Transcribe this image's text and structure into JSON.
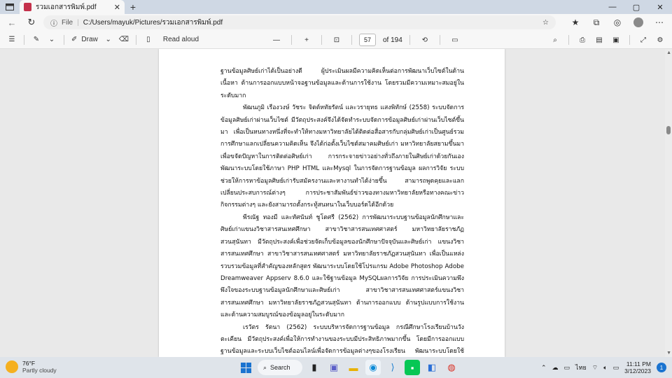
{
  "tab": {
    "title": "รวมเอกสารพิมพ์.pdf",
    "close": "✕",
    "new_tab": "+"
  },
  "window_controls": {
    "minimize": "—",
    "maximize": "▢",
    "close": "✕"
  },
  "address": {
    "scheme_label": "File",
    "url": "C:/Users/mayuk/Pictures/รวมเอกสารพิมพ์.pdf"
  },
  "pdf_toolbar": {
    "draw_label": "Draw",
    "read_aloud_label": "Read aloud",
    "zoom_out": "—",
    "zoom_in": "+",
    "current_page": "57",
    "total_pages": "of 194"
  },
  "document": {
    "paragraphs": [
      "ฐานข้อมูลศิษย์เก่าได้เป็นอย่างดี ผู้ประเมินผลมีความคิดเห็นต่อการพัฒนาเว็บไซต์ในด้านเนื้อหา ด้านการออกแบบหน้าจอฐานข้อมูลและด้านการใช้งาน โดยรวมมีความเหมาะสมอยู่ในระดับมาก",
      "พัฒนภูมิ เรืองวงษ์ วัชระ จิตต์หทัยรัตน์ และวรายุทธ แสงพิทักษ์ (2558) ระบบจัดการข้อมูลศิษย์เก่าผ่านเว็บไซต์ มีวัตถุประสงค์จึงได้จัดทำระบบจัดการข้อมูลศิษย์เก่าผ่านเว็บไซต์ขึ้นมา เพื่อเป็นหนทางหนึ่งที่จะทำให้ทางมหาวิทยาลัยได้ติดต่อสื่อสารกับกลุ่มศิษย์เก่าเป็นศูนย์รวมการศึกษาแลกเปลี่ยนความคิดเห็น จึงได้ก่อตั้งเว็บไซต์สมาคมศิษย์เก่า มหาวิทยาลัยสยามขึ้นมาเพื่อขจัดปัญหาในการติดต่อศิษย์เก่า การกระจายข่าวอย่างทั่วถึงภายในศิษย์เก่าด้วยกันเอง พัฒนาระบบโดยใช้ภาษา PHP HTML และMysql ในการจัดการฐานข้อมูล ผลการวิจัย ระบบช่วยให้การหาข้อมูลศิษย์เก่ารับสมัครงานและหางานทำได้ง่ายขึ้น สามารถพูดคุยและแลกเปลี่ยนประสบการณ์ต่างๆ การประชาสัมพันธ์ข่าวของทางมหาวิทยาลัยหรือทางคณะข่าวกิจกรรมต่างๆ และยังสามารถตั้งกระทู้สนทนาในเว็บบอร์ดได้อีกด้วย",
      "พีรณัฐ ทองมี และทัศนันท์ ชูโตศรี (2562) การพัฒนาระบบฐานข้อมูลนักศึกษาและศิษย์เก่าแขนงวิชาสารสนเทศศึกษา สาขาวิชาสารสนเทศศาสตร์ มหาวิทยาลัยราชภัฏสวนสุนันทา มีวัตถุประสงค์เพื่อช่วยจัดเก็บข้อมูลของนักศึกษาปัจจุบันและศิษย์เก่า แขนงวิชาสารสนเทศศึกษา สาขาวิชาสารสนเทศศาสตร์ มหาวิทยาลัยราชภัฏสวนสุนันทา เพื่อเป็นแหล่งรวบรวมข้อมูลที่สำคัญของหลักสูตร พัฒนาระบบโดยใช้โปรแกรม Adobe Photoshop Adobe Dreamweaver Appserv 8.6.0 และใช้ฐานข้อมูล MySQLผลการวิจัย การประเมินความพึงพึงใจของระบบฐานข้อมูลนักศึกษาและศิษย์เก่า สาขาวิชาสารสนเทศศาสตร์แขนงวิชาสารสนเทศศึกษา มหาวิทยาลัยราชภัฏสวนสุนันทา ด้านการออกแบบ ด้านรูปแบบการใช้งาน และด้านความสมบูรณ์ของข้อมูลอยู่ในระดับมาก",
      "เรวัตร รัตนา (2562) ระบบบริหารจัดการฐานข้อมูล กรณีศึกษาโรงเรียนบ้านวังตะเคียน มีวัตถุประสงค์เพื่อให้การทำงานของระบบมีประสิทธิภาพมากขึ้น โดยมีการออกแบบฐานข้อมูลและระบบเว็บไซต์ออนไลน์เพื่อจัดการข้อมูลต่างๆของโรงเรียน พัฒนาระบบโดยใช้เครื่องมือ PHP Appserv Apache MySQL phpMyAdmin ผลการวิจัยการพัฒนาระบบบริหารจัดการฐานข้อมูลโรงเรียนบ้านวังตะเคียน ระบบสามารถดำเนินงานได้ตามขอบเขตที่วางไว้ ทำให้มีระบบสามารถ"
    ]
  },
  "taskbar": {
    "weather_temp": "76°F",
    "weather_condition": "Partly cloudy",
    "search_label": "Search",
    "language": "ไทย",
    "time": "11:11 PM",
    "date": "3/12/2023",
    "notification_count": "1"
  }
}
